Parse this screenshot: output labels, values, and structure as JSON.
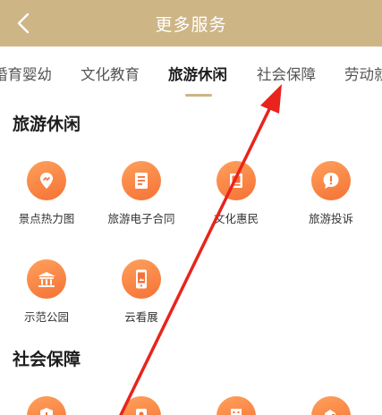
{
  "header": {
    "title": "更多服务"
  },
  "tabs": [
    {
      "label": "婚育婴幼",
      "active": false
    },
    {
      "label": "文化教育",
      "active": false
    },
    {
      "label": "旅游休闲",
      "active": true
    },
    {
      "label": "社会保障",
      "active": false
    },
    {
      "label": "劳动就业",
      "active": false
    }
  ],
  "sections": [
    {
      "title": "旅游休闲",
      "items": [
        {
          "label": "景点热力图",
          "icon": "location-pin-icon"
        },
        {
          "label": "旅游电子合同",
          "icon": "document-icon"
        },
        {
          "label": "文化惠民",
          "icon": "book-icon"
        },
        {
          "label": "旅游投诉",
          "icon": "alert-bubble-icon"
        },
        {
          "label": "示范公园",
          "icon": "pavilion-icon"
        },
        {
          "label": "云看展",
          "icon": "phone-screen-icon"
        }
      ]
    },
    {
      "title": "社会保障",
      "items": [
        {
          "label": "",
          "icon": "medical-shield-icon"
        },
        {
          "label": "",
          "icon": "card-icon"
        },
        {
          "label": "",
          "icon": "building-icon"
        },
        {
          "label": "",
          "icon": "hand-heart-icon"
        }
      ]
    }
  ],
  "colors": {
    "header_bg": "#cdb586",
    "icon_gradient_start": "#ffa05c",
    "icon_gradient_end": "#f47235",
    "annotation_arrow": "#e8241c"
  }
}
